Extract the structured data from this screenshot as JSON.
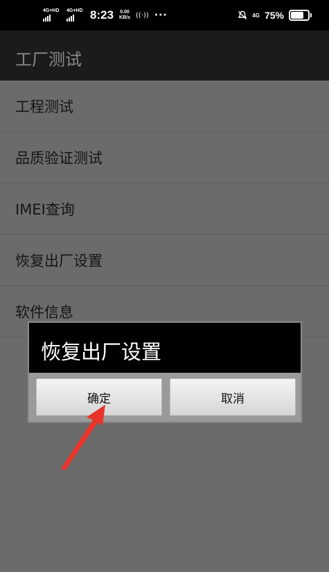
{
  "status_bar": {
    "sim1_network": "4G+HD",
    "sim2_network": "4G+HD",
    "time": "8:23",
    "speed_value": "0.00",
    "speed_unit": "KB/s",
    "hotspot_icon": "((·))",
    "more_dots": "···",
    "data_network": "4G",
    "battery_percent": "75%",
    "battery_level": 0.75
  },
  "app_bar": {
    "title": "工厂测试"
  },
  "menu": {
    "items": [
      {
        "label": "工程测试"
      },
      {
        "label": "品质验证测试"
      },
      {
        "label": "IMEI查询"
      },
      {
        "label": "恢复出厂设置"
      },
      {
        "label": "软件信息"
      }
    ]
  },
  "dialog": {
    "title": "恢复出厂设置",
    "confirm_label": "确定",
    "cancel_label": "取消"
  },
  "annotation": {
    "arrow_color": "#e8352c"
  }
}
